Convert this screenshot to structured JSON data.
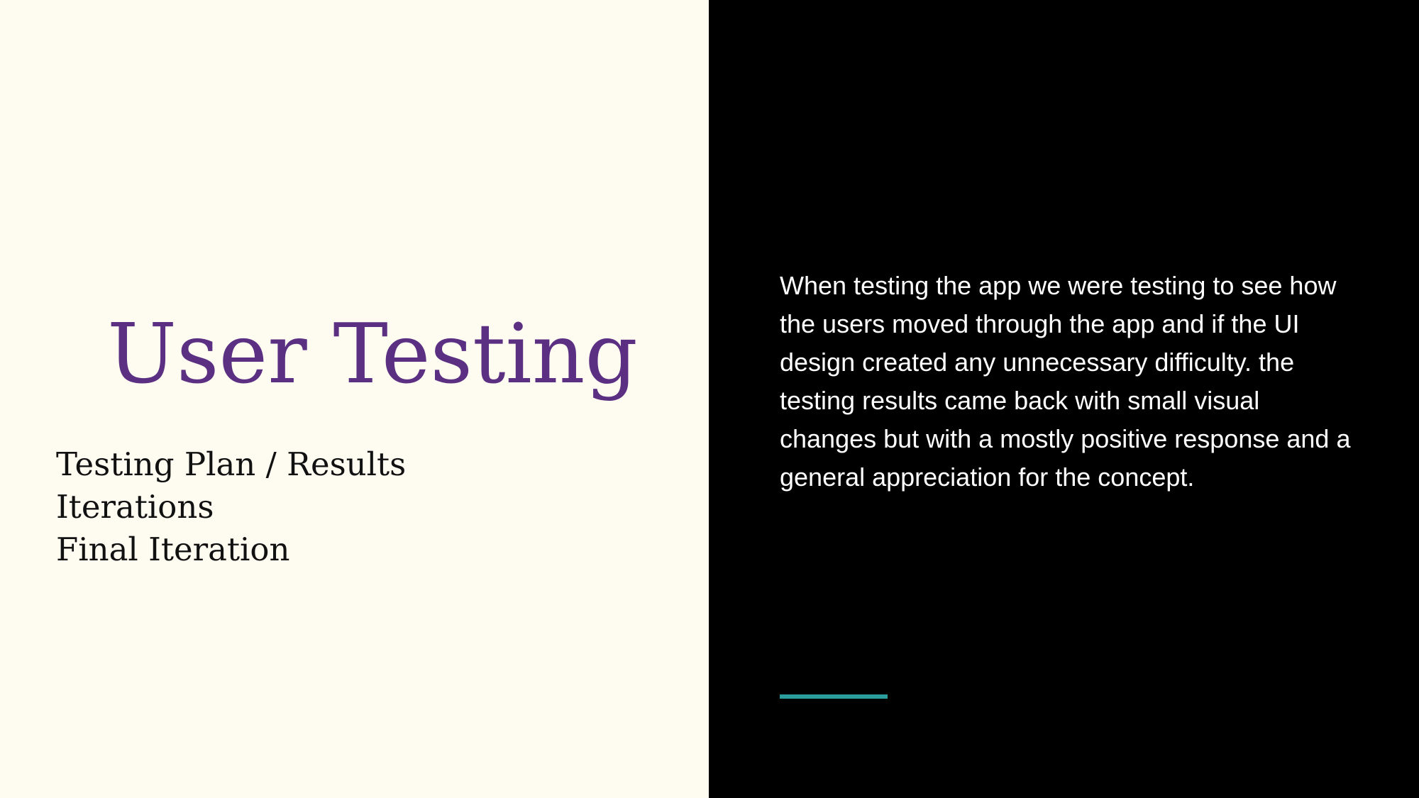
{
  "slide": {
    "title": "User Testing",
    "agenda": [
      "Testing Plan / Results",
      "Iterations",
      "Final Iteration"
    ],
    "body": "When testing the app we were testing to see how the users moved through the app and if the UI design created any unnecessary difficulty. the testing results came back with small visual changes but with a mostly positive response and a general appreciation for the concept."
  },
  "colors": {
    "left_background": "#fefbf1",
    "right_background": "#000000",
    "title": "#5b2f82",
    "agenda_text": "#111111",
    "body_text": "#ffffff",
    "accent": "#2a9d9c"
  }
}
